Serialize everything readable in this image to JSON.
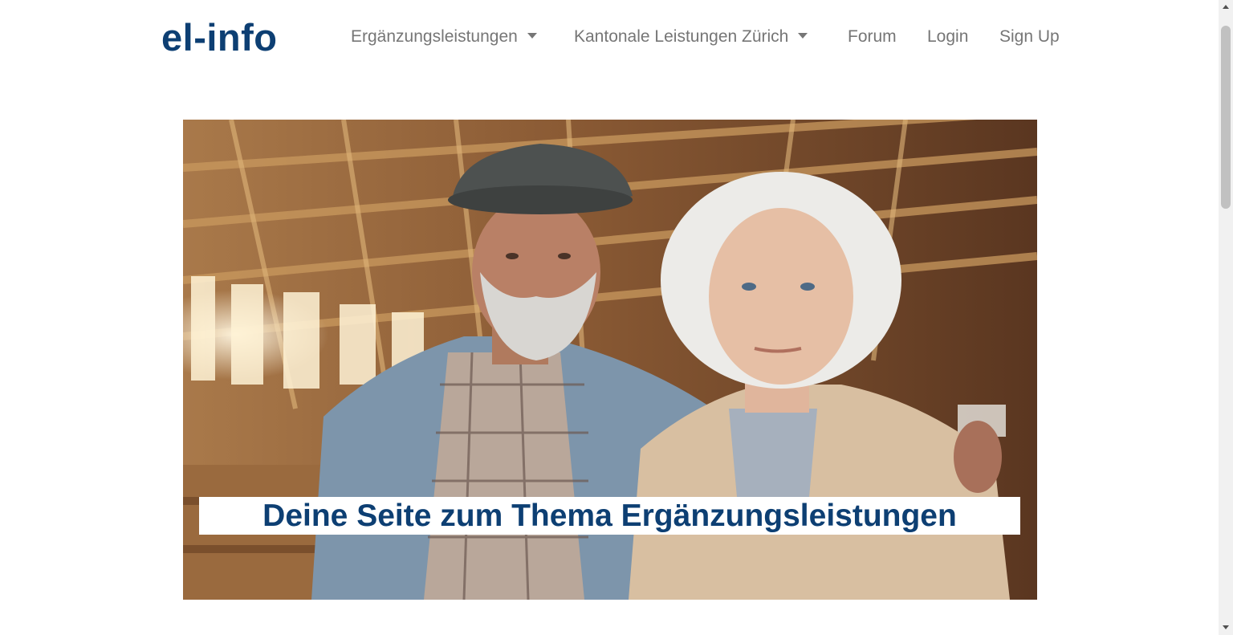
{
  "brand": {
    "name": "el-info",
    "color": "#0d3f73"
  },
  "nav": {
    "items": [
      {
        "label": "Ergänzungsleistungen",
        "dropdown": true
      },
      {
        "label": "Kantonale Leistungen Zürich",
        "dropdown": true
      },
      {
        "label": "Forum",
        "dropdown": false
      },
      {
        "label": "Login",
        "dropdown": false
      },
      {
        "label": "Sign Up",
        "dropdown": false
      }
    ],
    "link_color": "#767676"
  },
  "hero": {
    "caption": "Deine Seite zum Thema Ergänzungsleistungen"
  },
  "icons": {
    "dropdown": "caret-down-icon",
    "scroll_up": "scroll-up-arrow-icon",
    "scroll_down": "scroll-down-arrow-icon"
  }
}
